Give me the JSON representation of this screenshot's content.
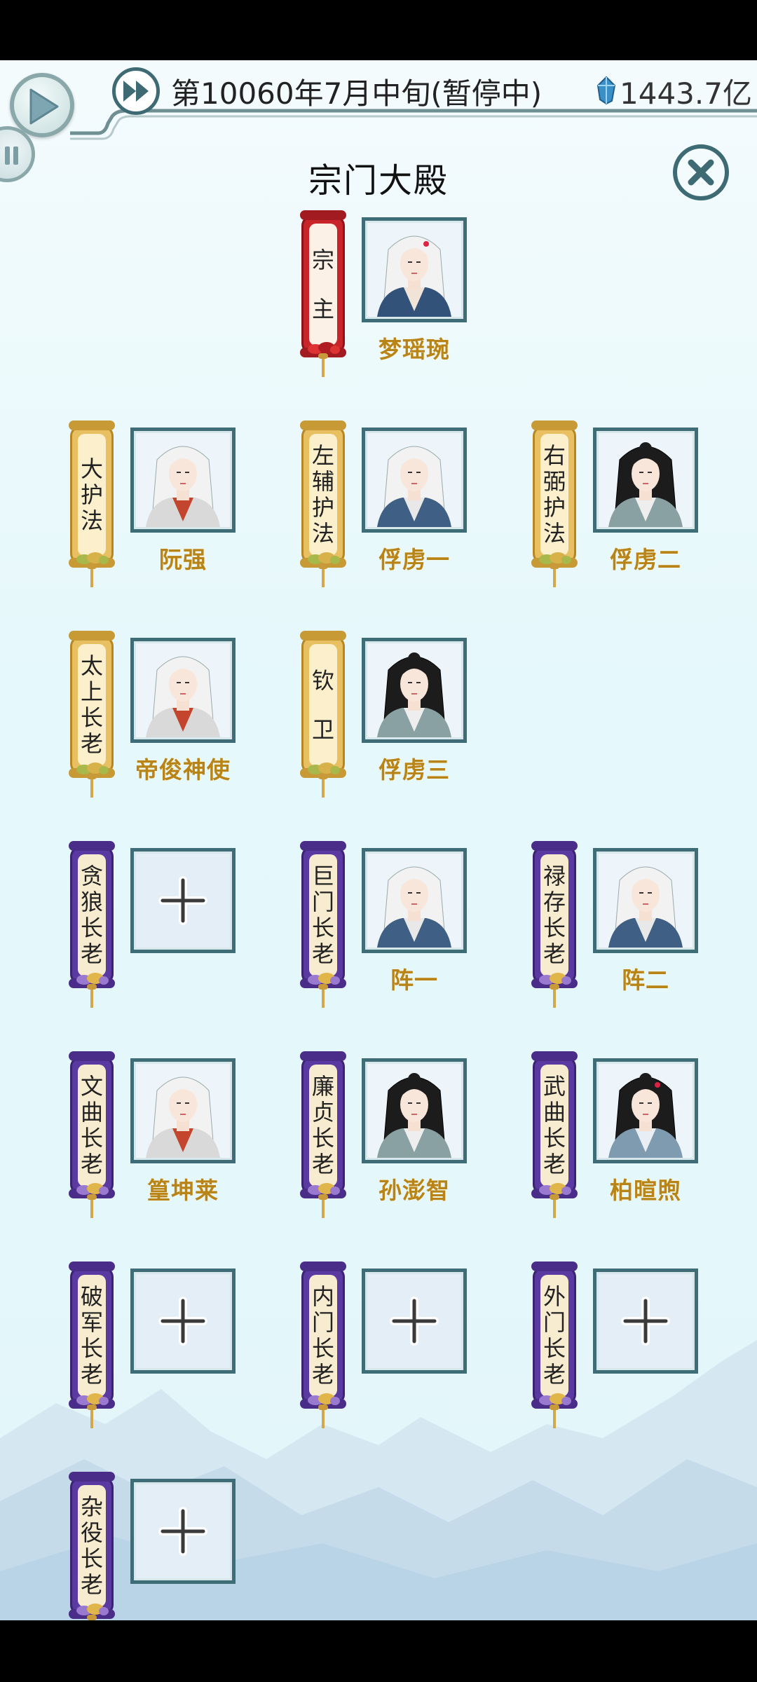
{
  "top_bar": {
    "date_status": "第10060年7月中旬(暂停中)",
    "currency_amount": "1443.7亿"
  },
  "title": "宗门大殿",
  "colors": {
    "frame_teal": "#3e6d77",
    "name_gold": "#b88417",
    "scroll_gold": "#e9c061",
    "scroll_red": "#c8252a",
    "scroll_purple": "#5a3aa0"
  },
  "positions": [
    {
      "role": "宗主",
      "tier": "red",
      "member": "梦瑶琬",
      "portrait": "white-hair-female"
    },
    {
      "role": "大护法",
      "tier": "gold",
      "member": "阮强",
      "portrait": "white-hair-red-robe"
    },
    {
      "role": "左辅护法",
      "tier": "gold",
      "member": "俘虏一",
      "portrait": "white-hair-blue-robe"
    },
    {
      "role": "右弼护法",
      "tier": "gold",
      "member": "俘虏二",
      "portrait": "black-hair"
    },
    {
      "role": "太上长老",
      "tier": "gold",
      "member": "帝俊神使",
      "portrait": "white-hair-red-robe"
    },
    {
      "role": "钦卫",
      "tier": "gold",
      "member": "俘虏三",
      "portrait": "black-hair"
    },
    {
      "role": "贪狼长老",
      "tier": "purple",
      "member": "",
      "portrait": "empty"
    },
    {
      "role": "巨门长老",
      "tier": "purple",
      "member": "阵一",
      "portrait": "white-hair-blue-robe"
    },
    {
      "role": "禄存长老",
      "tier": "purple",
      "member": "阵二",
      "portrait": "white-hair-blue-robe"
    },
    {
      "role": "文曲长老",
      "tier": "purple",
      "member": "篁坤莱",
      "portrait": "white-hair-red-robe"
    },
    {
      "role": "廉贞长老",
      "tier": "purple",
      "member": "孙澎智",
      "portrait": "black-hair"
    },
    {
      "role": "武曲长老",
      "tier": "purple",
      "member": "柏暄煦",
      "portrait": "black-hair-female"
    },
    {
      "role": "破军长老",
      "tier": "purple",
      "member": "",
      "portrait": "empty"
    },
    {
      "role": "内门长老",
      "tier": "purple",
      "member": "",
      "portrait": "empty"
    },
    {
      "role": "外门长老",
      "tier": "purple",
      "member": "",
      "portrait": "empty"
    },
    {
      "role": "杂役长老",
      "tier": "purple",
      "member": "",
      "portrait": "empty"
    }
  ],
  "icons": {
    "play": "play-icon",
    "pause": "pause-icon",
    "fast_forward": "fast-forward-icon",
    "currency": "spirit-stone-icon",
    "close": "close-icon",
    "add": "plus-icon"
  }
}
